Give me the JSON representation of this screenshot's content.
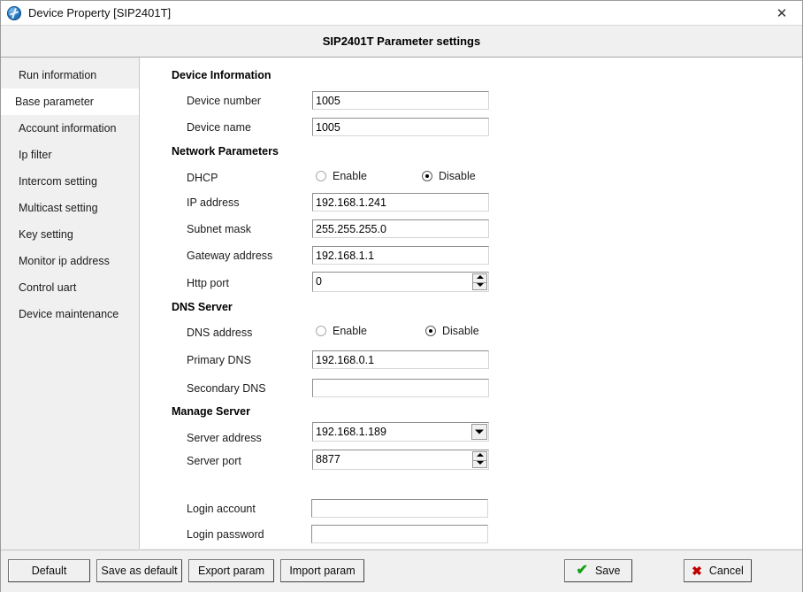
{
  "window": {
    "title": "Device Property [SIP2401T]",
    "app_icon": "globe-icon",
    "close_label": "✕"
  },
  "header": {
    "title": "SIP2401T Parameter settings"
  },
  "sidebar": {
    "items": [
      {
        "label": "Run information",
        "selected": false
      },
      {
        "label": "Base parameter",
        "selected": true
      },
      {
        "label": "Account information",
        "selected": false
      },
      {
        "label": "Ip filter",
        "selected": false
      },
      {
        "label": "Intercom setting",
        "selected": false
      },
      {
        "label": "Multicast setting",
        "selected": false
      },
      {
        "label": "Key setting",
        "selected": false
      },
      {
        "label": "Monitor ip address",
        "selected": false
      },
      {
        "label": "Control uart",
        "selected": false
      },
      {
        "label": "Device maintenance",
        "selected": false
      }
    ]
  },
  "sections": {
    "device_information": "Device Information",
    "network_parameters": "Network Parameters",
    "dns_server": "DNS Server",
    "manage_server": "Manage Server"
  },
  "fields": {
    "device_number": {
      "label": "Device number",
      "value": "1005"
    },
    "device_name": {
      "label": "Device name",
      "value": "1005"
    },
    "dhcp": {
      "label": "DHCP",
      "enable_label": "Enable",
      "disable_label": "Disable",
      "selected": "Disable"
    },
    "ip_address": {
      "label": "IP address",
      "value": "192.168.1.241"
    },
    "subnet_mask": {
      "label": "Subnet mask",
      "value": "255.255.255.0"
    },
    "gateway_address": {
      "label": "Gateway address",
      "value": "192.168.1.1"
    },
    "http_port": {
      "label": "Http port",
      "value": "0"
    },
    "dns_address": {
      "label": "DNS address",
      "enable_label": "Enable",
      "disable_label": "Disable",
      "selected": "Disable"
    },
    "primary_dns": {
      "label": "Primary DNS",
      "value": "192.168.0.1"
    },
    "secondary_dns": {
      "label": "Secondary DNS",
      "value": ""
    },
    "server_address": {
      "label": "Server address",
      "value": "192.168.1.189"
    },
    "server_port": {
      "label": "Server port",
      "value": "8877"
    },
    "login_account": {
      "label": "Login account",
      "value": ""
    },
    "login_password": {
      "label": "Login password",
      "value": ""
    }
  },
  "footer": {
    "default": "Default",
    "save_as_default": "Save as default",
    "export_param": "Export param",
    "import_param": "Import param",
    "save": "Save",
    "cancel": "Cancel",
    "save_icon": "check-icon",
    "cancel_icon": "cross-icon",
    "save_icon_glyph": "✔",
    "cancel_icon_glyph": "✖"
  },
  "colors": {
    "save_accent": "#12a012",
    "cancel_accent": "#c00000",
    "panel": "#f0f0f0",
    "selected_nav": "#ffffff"
  }
}
